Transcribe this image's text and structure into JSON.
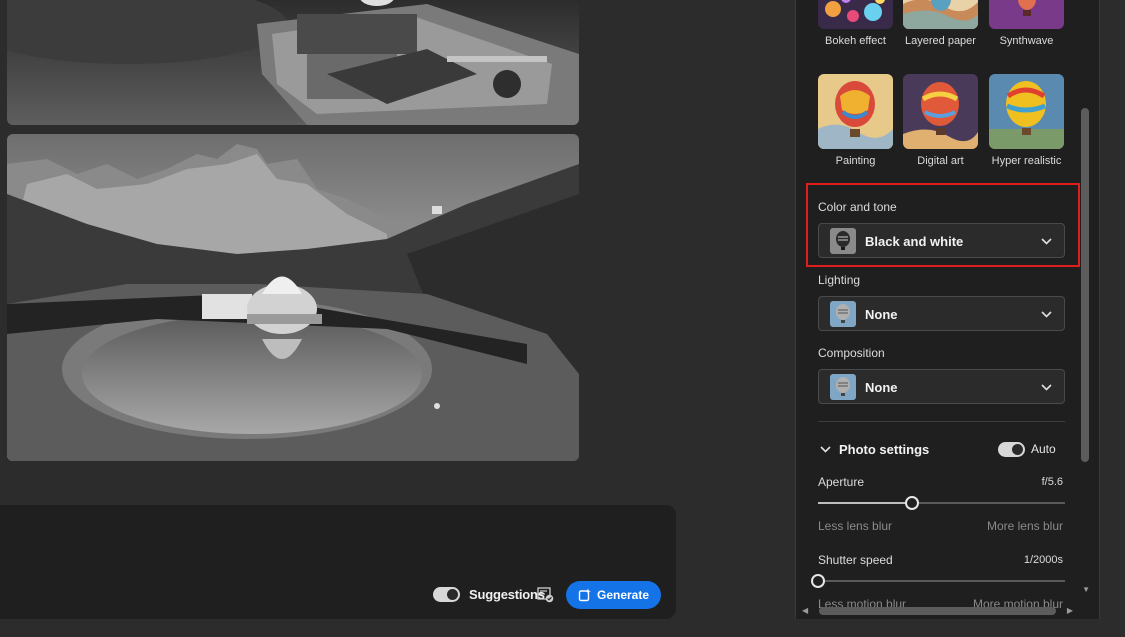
{
  "prompt_bar": {
    "suggestions_label": "Suggestions",
    "generate_label": "Generate"
  },
  "styles": [
    {
      "label": "Bokeh effect"
    },
    {
      "label": "Layered paper"
    },
    {
      "label": "Synthwave"
    },
    {
      "label": "Painting"
    },
    {
      "label": "Digital art"
    },
    {
      "label": "Hyper realistic"
    }
  ],
  "color_and_tone": {
    "label": "Color and tone",
    "value": "Black and white"
  },
  "lighting": {
    "label": "Lighting",
    "value": "None"
  },
  "composition": {
    "label": "Composition",
    "value": "None"
  },
  "photo_settings": {
    "title": "Photo settings",
    "auto_label": "Auto",
    "auto_enabled": true,
    "aperture": {
      "label": "Aperture",
      "value": "f/5.6",
      "level": 0.38,
      "min_label": "Less lens blur",
      "max_label": "More lens blur"
    },
    "shutter_speed": {
      "label": "Shutter speed",
      "value": "1/2000s",
      "level": 0.0,
      "min_label": "Less motion blur",
      "max_label": "More motion blur"
    }
  },
  "colors": {
    "accent": "#1473e6",
    "highlight": "#e01e1e",
    "panel_bg": "#1f1f1f",
    "app_bg": "#2c2c2c"
  }
}
